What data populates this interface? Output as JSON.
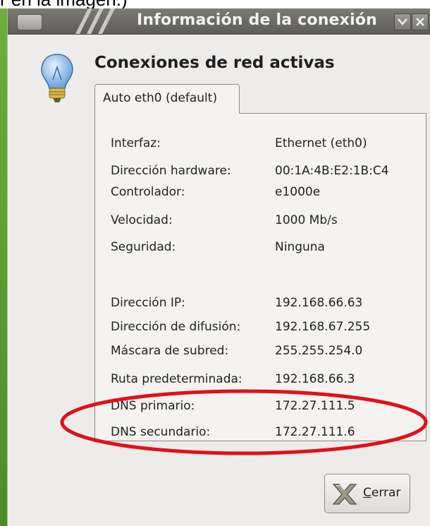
{
  "caption": "r en la imagen.)",
  "window": {
    "title": "Información de la conexión",
    "menu_icon": "window-menu-icon",
    "minimize_icon": "chevron-down-icon",
    "close_icon": "close-icon"
  },
  "heading": "Conexiones de red activas",
  "tab_label": "Auto eth0 (default)",
  "info_rows": [
    {
      "label": "Interfaz:",
      "value": "Ethernet (eth0)"
    },
    {
      "label": "Dirección hardware:",
      "value": "00:1A:4B:E2:1B:C4"
    },
    {
      "label": "Controlador:",
      "value": "e1000e"
    },
    {
      "label": "Velocidad:",
      "value": "1000 Mb/s"
    },
    {
      "label": "Seguridad:",
      "value": "Ninguna"
    },
    {
      "label": "Dirección IP:",
      "value": "192.168.66.63"
    },
    {
      "label": "Dirección de difusión:",
      "value": "192.168.67.255"
    },
    {
      "label": "Máscara de subred:",
      "value": "255.255.254.0"
    },
    {
      "label": "Ruta predeterminada:",
      "value": "192.168.66.3"
    },
    {
      "label": "DNS primario:",
      "value": "172.27.111.5"
    },
    {
      "label": "DNS secundario:",
      "value": "172.27.111.6"
    }
  ],
  "close_button": {
    "first": "C",
    "rest": "errar"
  },
  "colors": {
    "titlebar": "#6b6a66",
    "window_bg": "#edecea",
    "annotation_oval": "#e0101a",
    "bulb": "#7fb4e8"
  }
}
